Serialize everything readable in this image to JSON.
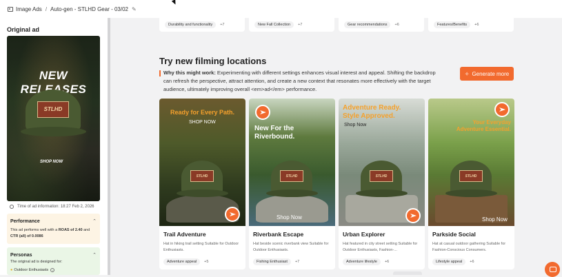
{
  "breadcrumb": {
    "root": "Image Ads",
    "separator": "/",
    "current": "Auto-gen - STLHD Gear - 03/02"
  },
  "sidebar": {
    "title": "Original ad",
    "ad": {
      "headline": "NEW RELEASES",
      "patch_text": "STLHD",
      "cta": "SHOP NOW"
    },
    "time_info": "Time of ad information: 18:27 Feb 2, 2026",
    "performance": {
      "title": "Performance",
      "text_prefix": "This ad performs well with a ",
      "roas_label": "ROAS of 2.40",
      "text_mid": " and ",
      "ctr_label": "CTR (all) of 0.0086"
    },
    "personas": {
      "title": "Personas",
      "text": "The original ad is designed for:",
      "tag": "Outdoor Enthusiasts"
    }
  },
  "top_cards": [
    {
      "tag": "Durability and functionality",
      "count": "+7"
    },
    {
      "tag": "New Fall Collection",
      "count": "+7"
    },
    {
      "tag": "Gear recommendations",
      "count": "+6"
    },
    {
      "tag": "Features/Benefits",
      "count": "+6"
    }
  ],
  "section": {
    "title": "Try new filming locations",
    "why_label": "Why this might work:",
    "why_text": " Experimenting with different settings enhances visual interest and appeal. Shifting the backdrop can refresh the perspective, attract attention, and create a new context that resonates more effectively with the target audience, ultimately improving overall <em>ad</em> performance.",
    "generate_label": "Generate more"
  },
  "locations": [
    {
      "image_headline": "Ready for Every Path.",
      "image_cta": "SHOP NOW",
      "name": "Trail Adventure",
      "description": "Hat in hiking trail setting Suitable for Outdoor Enthusiasts.",
      "tag": "Adventure appeal",
      "count": "+5"
    },
    {
      "image_headline": "New For the Riverbound.",
      "image_cta": "Shop Now",
      "name": "Riverbank Escape",
      "description": "Hat beside scenic riverbank view Suitable for Outdoor Enthusiasts.",
      "tag": "Fishing Enthusiast",
      "count": "+7"
    },
    {
      "image_headline": "Adventure Ready. Style Approved.",
      "image_cta": "Shop Now",
      "name": "Urban Explorer",
      "description": "Hat featured in city street setting Suitable for Outdoor Enthusiasts, Fashion-...",
      "tag": "Adventure lifestyle",
      "count": "+6"
    },
    {
      "image_headline": "Your Everyday Adventure Essential.",
      "image_cta": "Shop Now",
      "name": "Parkside Social",
      "description": "Hat at casual outdoor gathering Suitable for Fashion-Conscious Consumers.",
      "tag": "Lifestyle appeal",
      "count": "+6"
    }
  ],
  "colors": {
    "accent": "#f26a2e",
    "performance_bg": "#fdf4e4",
    "personas_bg": "#eaf6e6"
  }
}
